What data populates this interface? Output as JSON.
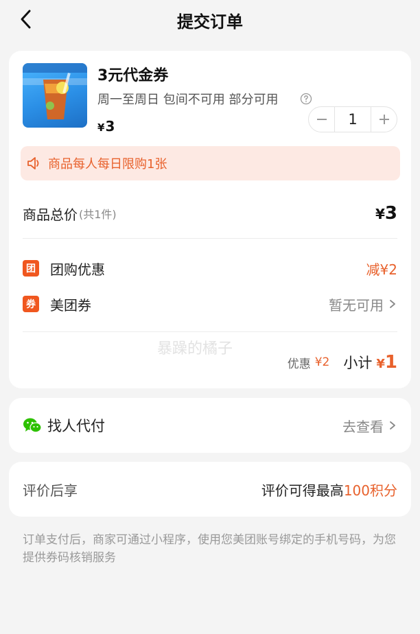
{
  "header": {
    "title": "提交订单"
  },
  "product": {
    "title": "3元代金券",
    "meta": "周一至周日 包间不可用 部分可用",
    "currency": "¥",
    "price": "3",
    "quantity": "1"
  },
  "limit_notice": "商品每人每日限购1张",
  "total": {
    "label": "商品总价",
    "count": "(共1件)",
    "currency": "¥",
    "amount": "3"
  },
  "discounts": [
    {
      "badge": "团",
      "label": "团购优惠",
      "value": "减¥2"
    },
    {
      "badge": "券",
      "label": "美团券",
      "value": "暂无可用"
    }
  ],
  "subtotal": {
    "discount_label": "优惠",
    "discount_amount": "¥2",
    "label": "小计",
    "currency": "¥",
    "amount": "1"
  },
  "watermark": "暴躁的橘子",
  "pay_for_me": {
    "label": "找人代付",
    "link": "去查看"
  },
  "review": {
    "label": "评价后享",
    "desc_prefix": "评价可得最高",
    "points": "100积分"
  },
  "footer_note": "订单支付后，商家可通过小程序，使用您美团账号绑定的手机号码，为您提供券码核销服务",
  "colors": {
    "accent": "#e8612c",
    "badge": "#f0571f",
    "banner_bg": "#fde9e3",
    "wechat": "#2dc100"
  },
  "icons": {
    "back": "chevron-left-icon",
    "help": "question-circle-icon",
    "speaker": "speaker-icon",
    "chevron": "chevron-right-icon",
    "wechat": "wechat-icon"
  }
}
